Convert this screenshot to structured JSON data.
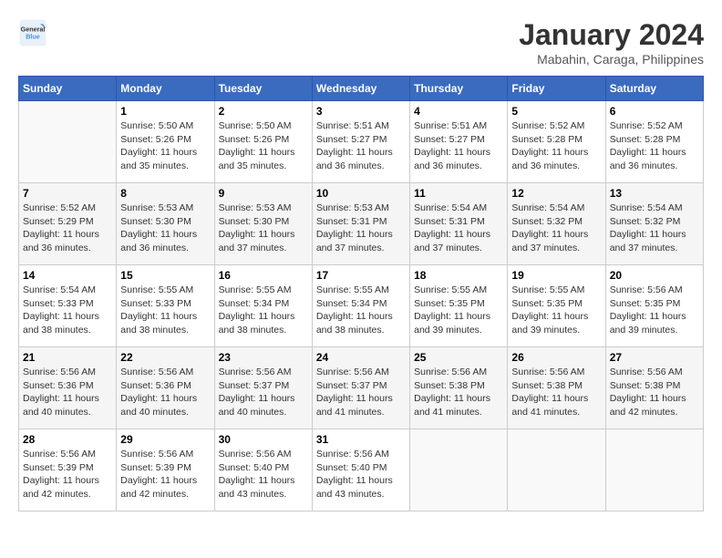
{
  "header": {
    "logo_line1": "General",
    "logo_line2": "Blue",
    "month": "January 2024",
    "location": "Mabahin, Caraga, Philippines"
  },
  "weekdays": [
    "Sunday",
    "Monday",
    "Tuesday",
    "Wednesday",
    "Thursday",
    "Friday",
    "Saturday"
  ],
  "weeks": [
    [
      {
        "day": "",
        "info": ""
      },
      {
        "day": "1",
        "info": "Sunrise: 5:50 AM\nSunset: 5:26 PM\nDaylight: 11 hours\nand 35 minutes."
      },
      {
        "day": "2",
        "info": "Sunrise: 5:50 AM\nSunset: 5:26 PM\nDaylight: 11 hours\nand 35 minutes."
      },
      {
        "day": "3",
        "info": "Sunrise: 5:51 AM\nSunset: 5:27 PM\nDaylight: 11 hours\nand 36 minutes."
      },
      {
        "day": "4",
        "info": "Sunrise: 5:51 AM\nSunset: 5:27 PM\nDaylight: 11 hours\nand 36 minutes."
      },
      {
        "day": "5",
        "info": "Sunrise: 5:52 AM\nSunset: 5:28 PM\nDaylight: 11 hours\nand 36 minutes."
      },
      {
        "day": "6",
        "info": "Sunrise: 5:52 AM\nSunset: 5:28 PM\nDaylight: 11 hours\nand 36 minutes."
      }
    ],
    [
      {
        "day": "7",
        "info": "Sunrise: 5:52 AM\nSunset: 5:29 PM\nDaylight: 11 hours\nand 36 minutes."
      },
      {
        "day": "8",
        "info": "Sunrise: 5:53 AM\nSunset: 5:30 PM\nDaylight: 11 hours\nand 36 minutes."
      },
      {
        "day": "9",
        "info": "Sunrise: 5:53 AM\nSunset: 5:30 PM\nDaylight: 11 hours\nand 37 minutes."
      },
      {
        "day": "10",
        "info": "Sunrise: 5:53 AM\nSunset: 5:31 PM\nDaylight: 11 hours\nand 37 minutes."
      },
      {
        "day": "11",
        "info": "Sunrise: 5:54 AM\nSunset: 5:31 PM\nDaylight: 11 hours\nand 37 minutes."
      },
      {
        "day": "12",
        "info": "Sunrise: 5:54 AM\nSunset: 5:32 PM\nDaylight: 11 hours\nand 37 minutes."
      },
      {
        "day": "13",
        "info": "Sunrise: 5:54 AM\nSunset: 5:32 PM\nDaylight: 11 hours\nand 37 minutes."
      }
    ],
    [
      {
        "day": "14",
        "info": "Sunrise: 5:54 AM\nSunset: 5:33 PM\nDaylight: 11 hours\nand 38 minutes."
      },
      {
        "day": "15",
        "info": "Sunrise: 5:55 AM\nSunset: 5:33 PM\nDaylight: 11 hours\nand 38 minutes."
      },
      {
        "day": "16",
        "info": "Sunrise: 5:55 AM\nSunset: 5:34 PM\nDaylight: 11 hours\nand 38 minutes."
      },
      {
        "day": "17",
        "info": "Sunrise: 5:55 AM\nSunset: 5:34 PM\nDaylight: 11 hours\nand 38 minutes."
      },
      {
        "day": "18",
        "info": "Sunrise: 5:55 AM\nSunset: 5:35 PM\nDaylight: 11 hours\nand 39 minutes."
      },
      {
        "day": "19",
        "info": "Sunrise: 5:55 AM\nSunset: 5:35 PM\nDaylight: 11 hours\nand 39 minutes."
      },
      {
        "day": "20",
        "info": "Sunrise: 5:56 AM\nSunset: 5:35 PM\nDaylight: 11 hours\nand 39 minutes."
      }
    ],
    [
      {
        "day": "21",
        "info": "Sunrise: 5:56 AM\nSunset: 5:36 PM\nDaylight: 11 hours\nand 40 minutes."
      },
      {
        "day": "22",
        "info": "Sunrise: 5:56 AM\nSunset: 5:36 PM\nDaylight: 11 hours\nand 40 minutes."
      },
      {
        "day": "23",
        "info": "Sunrise: 5:56 AM\nSunset: 5:37 PM\nDaylight: 11 hours\nand 40 minutes."
      },
      {
        "day": "24",
        "info": "Sunrise: 5:56 AM\nSunset: 5:37 PM\nDaylight: 11 hours\nand 41 minutes."
      },
      {
        "day": "25",
        "info": "Sunrise: 5:56 AM\nSunset: 5:38 PM\nDaylight: 11 hours\nand 41 minutes."
      },
      {
        "day": "26",
        "info": "Sunrise: 5:56 AM\nSunset: 5:38 PM\nDaylight: 11 hours\nand 41 minutes."
      },
      {
        "day": "27",
        "info": "Sunrise: 5:56 AM\nSunset: 5:38 PM\nDaylight: 11 hours\nand 42 minutes."
      }
    ],
    [
      {
        "day": "28",
        "info": "Sunrise: 5:56 AM\nSunset: 5:39 PM\nDaylight: 11 hours\nand 42 minutes."
      },
      {
        "day": "29",
        "info": "Sunrise: 5:56 AM\nSunset: 5:39 PM\nDaylight: 11 hours\nand 42 minutes."
      },
      {
        "day": "30",
        "info": "Sunrise: 5:56 AM\nSunset: 5:40 PM\nDaylight: 11 hours\nand 43 minutes."
      },
      {
        "day": "31",
        "info": "Sunrise: 5:56 AM\nSunset: 5:40 PM\nDaylight: 11 hours\nand 43 minutes."
      },
      {
        "day": "",
        "info": ""
      },
      {
        "day": "",
        "info": ""
      },
      {
        "day": "",
        "info": ""
      }
    ]
  ]
}
